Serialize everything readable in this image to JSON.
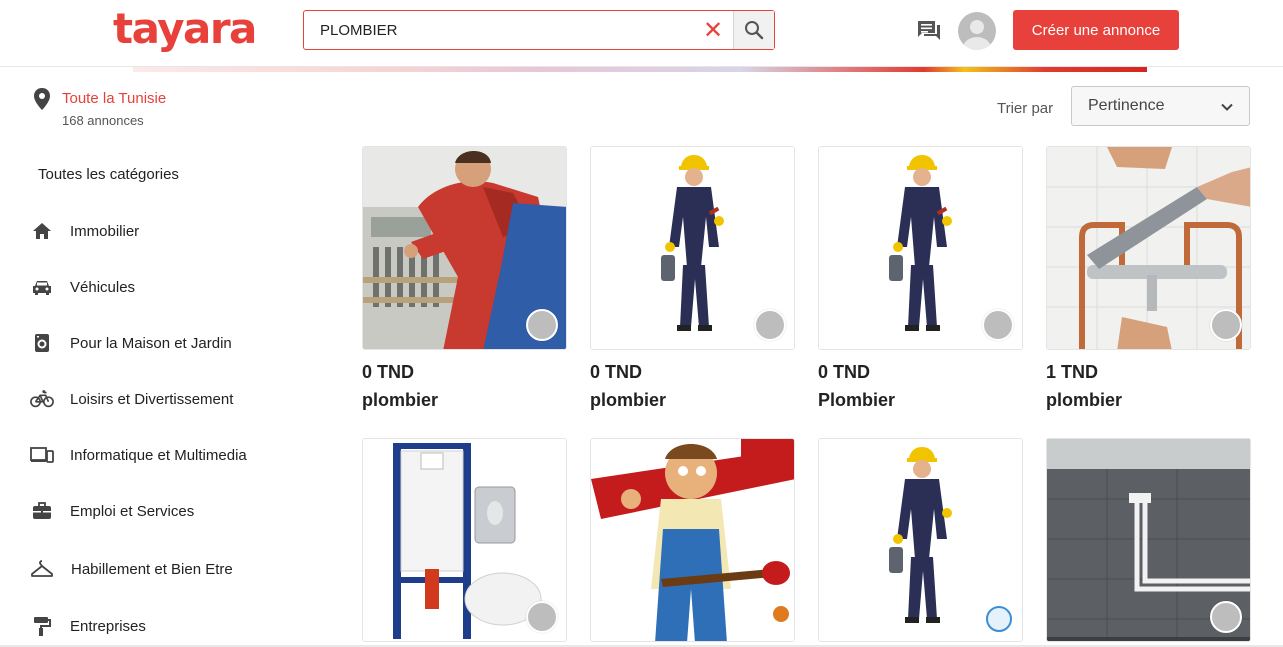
{
  "header": {
    "logo": "tayara",
    "search_value": "PLOMBIER",
    "create_ad_label": "Créer une annonce"
  },
  "location": {
    "title": "Toute la Tunisie",
    "count": "168 annonces"
  },
  "sidebar": {
    "all_categories": "Toutes les catégories",
    "items": [
      {
        "label": "Immobilier",
        "icon": "home-icon"
      },
      {
        "label": "Véhicules",
        "icon": "car-icon"
      },
      {
        "label": "Pour la Maison et Jardin",
        "icon": "washing-machine-icon"
      },
      {
        "label": "Loisirs et Divertissement",
        "icon": "bicycle-icon"
      },
      {
        "label": "Informatique et Multimedia",
        "icon": "devices-icon"
      },
      {
        "label": "Emploi et Services",
        "icon": "briefcase-icon"
      },
      {
        "label": "Habillement et Bien Etre",
        "icon": "hanger-icon"
      },
      {
        "label": "Entreprises",
        "icon": "paint-roller-icon"
      }
    ]
  },
  "sort": {
    "label": "Trier par",
    "selected": "Pertinence"
  },
  "listings": [
    {
      "price": "0 TND",
      "title": "plombier",
      "image": "plumber-working-photo"
    },
    {
      "price": "0 TND",
      "title": "plombier",
      "image": "worker-in-overalls"
    },
    {
      "price": "0 TND",
      "title": "Plombier",
      "image": "worker-in-overalls"
    },
    {
      "price": "1 TND",
      "title": "plombier",
      "image": "wrench-on-faucet-photo"
    },
    {
      "image": "grohe-toilet-frame"
    },
    {
      "image": "cartoon-plumber"
    },
    {
      "image": "worker-in-overalls"
    },
    {
      "image": "bathroom-pipes-photo"
    }
  ],
  "colors": {
    "brand": "#e8403a",
    "text": "#222222",
    "muted": "#555555"
  }
}
